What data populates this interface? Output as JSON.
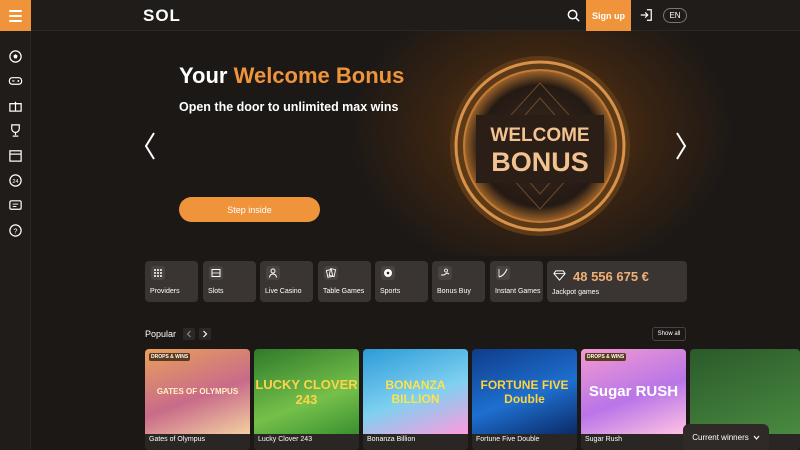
{
  "header": {
    "logo_text": "SOL",
    "signup_label": "Sign up",
    "lang_label": "EN"
  },
  "sidebar": {
    "icons": [
      "soccer-ball-icon",
      "gamepad-icon",
      "gift-icon",
      "trophy-icon",
      "calendar-icon",
      "speed-icon",
      "chat-icon",
      "help-icon"
    ]
  },
  "hero": {
    "title_plain": "Your ",
    "title_accent": "Welcome Bonus",
    "subtitle": "Open the door to unlimited max wins",
    "cta_label": "Step inside",
    "medal_line1": "WELCOME",
    "medal_line2": "BONUS"
  },
  "categories": [
    {
      "label": "Providers"
    },
    {
      "label": "Slots"
    },
    {
      "label": "Live Casino"
    },
    {
      "label": "Table Games"
    },
    {
      "label": "Sports"
    },
    {
      "label": "Bonus Buy"
    },
    {
      "label": "Instant Games"
    }
  ],
  "jackpot": {
    "value": "48 556 675 €",
    "label": "Jackpot games"
  },
  "popular": {
    "title": "Popular",
    "show_all": "Show all",
    "games": [
      {
        "name": "Gates of Olympus",
        "art": "GATES OF OLYMPUS",
        "badge": "DROPS & WINS"
      },
      {
        "name": "Lucky Clover 243",
        "art": "LUCKY CLOVER 243",
        "badge": ""
      },
      {
        "name": "Bonanza Billion",
        "art": "BONANZA BILLION",
        "badge": ""
      },
      {
        "name": "Fortune Five Double",
        "art": "FORTUNE FIVE Double",
        "badge": ""
      },
      {
        "name": "Sugar Rush",
        "art": "Sugar RUSH",
        "badge": "DROPS & WINS"
      }
    ]
  },
  "winners": {
    "label": "Current winners"
  },
  "colors": {
    "accent": "#f0943c",
    "background": "#1b1816",
    "tile": "#3a3532"
  }
}
